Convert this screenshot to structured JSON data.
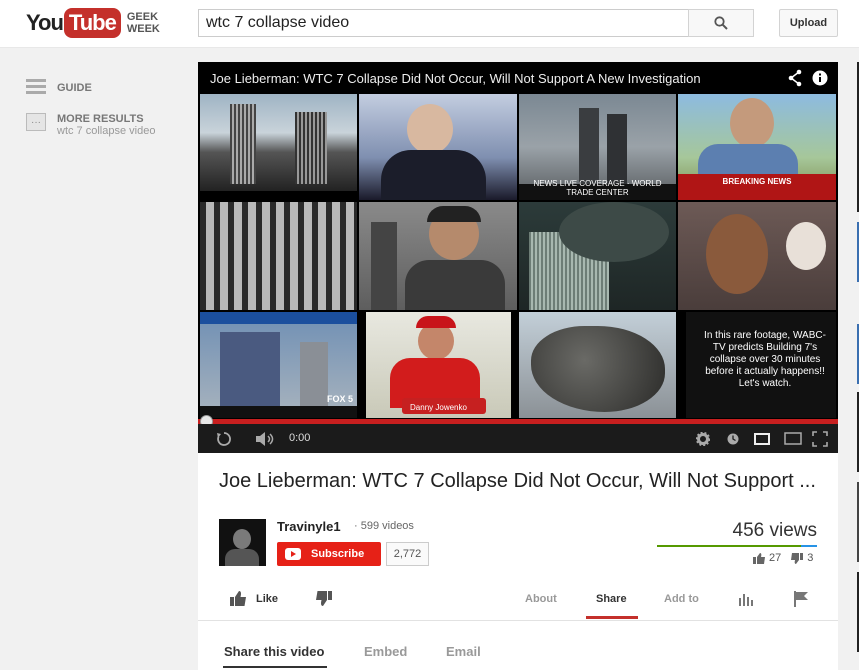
{
  "masthead": {
    "logo_you": "You",
    "logo_tube": "Tube",
    "doodle_line1": "GEEK",
    "doodle_line2": "WEEK",
    "search_value": "wtc 7 collapse video",
    "upload_label": "Upload"
  },
  "guide": {
    "guide_label": "GUIDE",
    "more_results_label": "MORE RESULTS",
    "more_results_query": "wtc 7 collapse video"
  },
  "player": {
    "title": "Joe Lieberman: WTC 7 Collapse Did Not Occur, Will Not Support A New Investigation",
    "time": "0:00",
    "tile_captions": {
      "wtc_banner": "NEWS LIVE COVERAGE · WORLD TRADE CENTER",
      "breaking": "BREAKING NEWS",
      "fox5": "FOX 5",
      "danny": "Danny Jowenko",
      "rare_footage": "In this rare footage, WABC-TV predicts Building 7's collapse over 30 minutes before it actually happens!! Let's watch."
    },
    "progress_fraction": 0
  },
  "watch": {
    "title": "Joe Lieberman: WTC 7 Collapse Did Not Occur, Will Not Support ...",
    "channel_name": "Travinyle1",
    "video_count": "· 599 videos",
    "subscribe_label": "Subscribe",
    "subscriber_count": "2,772",
    "views": "456 views",
    "likes": "27",
    "dislikes": "3",
    "like_label": "Like",
    "tabs": [
      "About",
      "Share",
      "Add to"
    ],
    "active_tab": "Share",
    "share_tabs": [
      "Share this video",
      "Embed",
      "Email"
    ]
  },
  "colors": {
    "brand_red": "#c4302b",
    "subscribe_red": "#e62117",
    "like_green": "#559900",
    "dislike_blue": "#2793e6"
  }
}
